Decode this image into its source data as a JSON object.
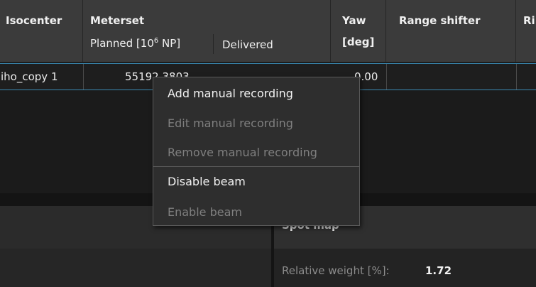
{
  "table": {
    "headers": {
      "isocenter": "Isocenter",
      "meterset": "Meterset",
      "planned_prefix": "Planned [10",
      "planned_sup": "6",
      "planned_suffix": " NP]",
      "delivered": "Delivered",
      "yaw_line1": "Yaw",
      "yaw_line2": "[deg]",
      "range_shifter": "Range shifter",
      "ripple": "Ripp"
    },
    "row": {
      "isocenter": "iho_copy 1",
      "planned": "55192.3803",
      "yaw": "0.00"
    }
  },
  "context_menu": {
    "items": [
      {
        "label": "Add manual recording",
        "enabled": true
      },
      {
        "label": "Edit manual recording",
        "enabled": false
      },
      {
        "label": "Remove manual recording",
        "enabled": false
      },
      {
        "label": "Disable beam",
        "enabled": true
      },
      {
        "label": "Enable beam",
        "enabled": false
      }
    ]
  },
  "spot_map": {
    "title": "Spot map",
    "relative_weight_label": "Relative weight [%]:",
    "relative_weight_value": "1.72"
  },
  "colors": {
    "selection_border": "#3a89b2",
    "menu_background": "#2e2e2e",
    "disabled_text": "#7f7f7f"
  }
}
